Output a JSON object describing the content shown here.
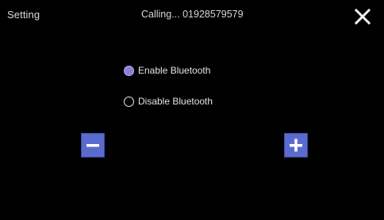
{
  "header": {
    "title": "Setting",
    "call_status": "Calling... 01928579579",
    "close_icon": "close-icon"
  },
  "bluetooth": {
    "options": [
      {
        "label": "Enable Bluetooth",
        "selected": true
      },
      {
        "label": "Disable Bluetooth",
        "selected": false
      }
    ]
  },
  "volume": {
    "decrease_icon": "minus-icon",
    "increase_icon": "plus-icon"
  },
  "colors": {
    "background": "#000000",
    "accent": "#5a6bd0",
    "radio_selected": "#8c7fd6",
    "text": "#e4e4e4"
  }
}
